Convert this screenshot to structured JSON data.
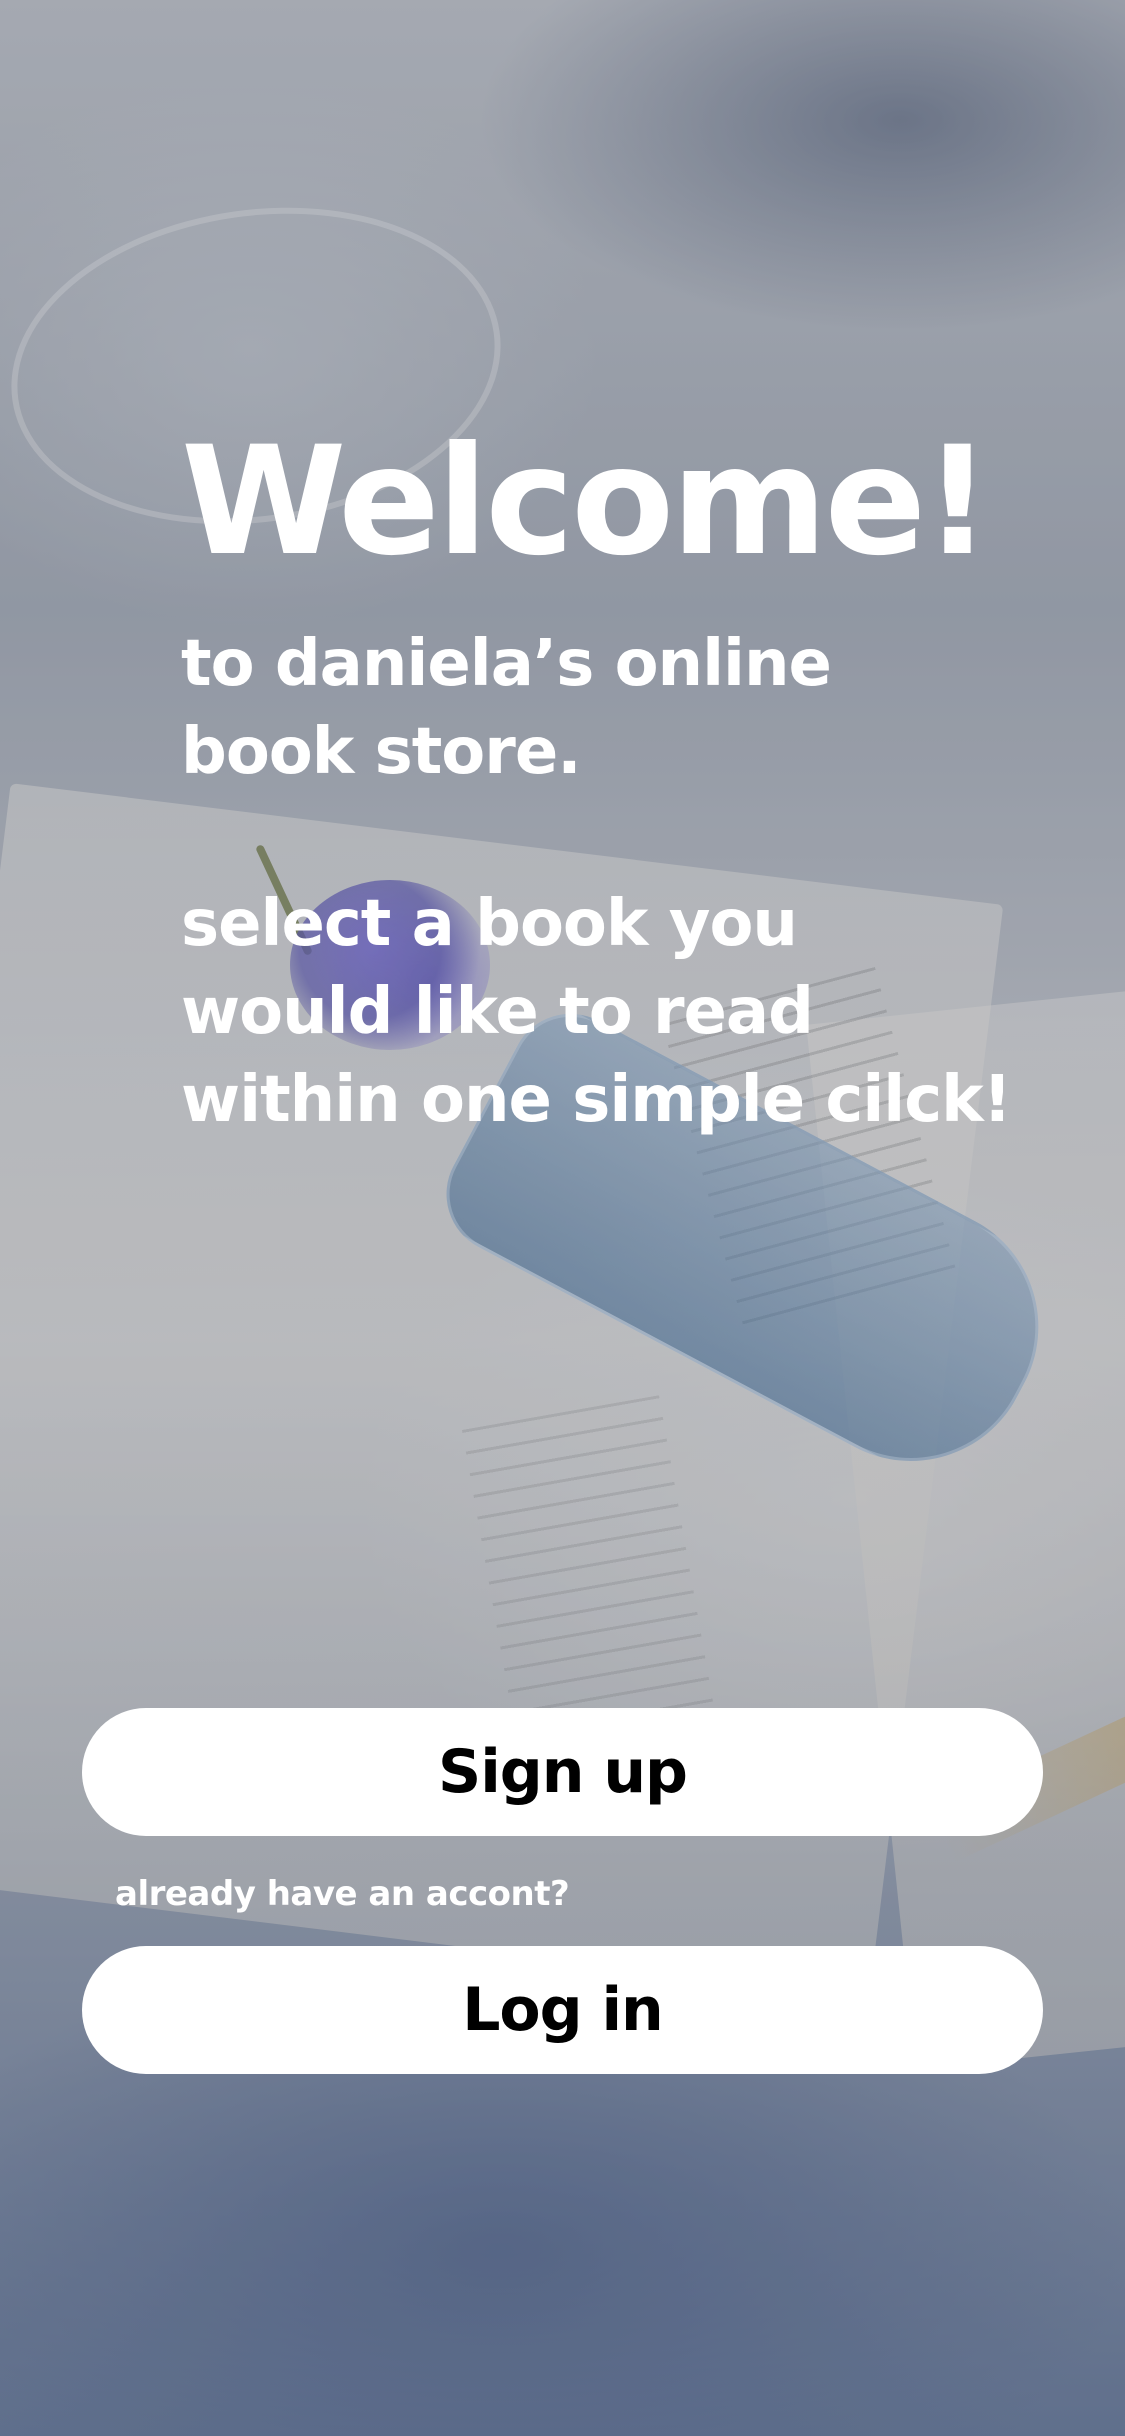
{
  "welcome": {
    "title": "Welcome!",
    "subtitle": "to daniela’s online book store.",
    "tagline": "select a book you would like to read within one simple cilck!"
  },
  "actions": {
    "signup_label": "Sign up",
    "login_prompt": "already have an accont?",
    "login_label": "Log in"
  },
  "colors": {
    "text": "#ffffff",
    "button_bg": "#ffffff",
    "button_text": "#000000"
  }
}
